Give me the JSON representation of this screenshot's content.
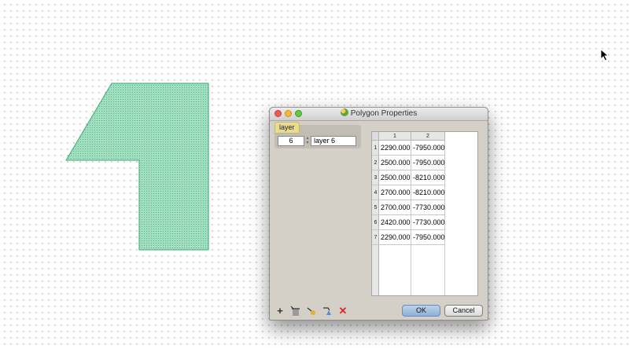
{
  "dialog": {
    "title": "Polygon Properties",
    "layer_group_label": "layer",
    "layer_number": "6",
    "layer_name": "layer 6",
    "table": {
      "columns": [
        "1",
        "2"
      ],
      "rows": [
        {
          "index": "1",
          "x": "2290.000",
          "y": "-7950.000"
        },
        {
          "index": "2",
          "x": "2500.000",
          "y": "-7950.000"
        },
        {
          "index": "3",
          "x": "2500.000",
          "y": "-8210.000"
        },
        {
          "index": "4",
          "x": "2700.000",
          "y": "-8210.000"
        },
        {
          "index": "5",
          "x": "2700.000",
          "y": "-7730.000"
        },
        {
          "index": "6",
          "x": "2420.000",
          "y": "-7730.000"
        },
        {
          "index": "7",
          "x": "2290.000",
          "y": "-7950.000"
        }
      ]
    },
    "toolbar_icons": [
      "add-point-icon",
      "delete-point-icon",
      "move-up-icon",
      "move-down-icon",
      "remove-icon"
    ],
    "ok_label": "OK",
    "cancel_label": "Cancel"
  },
  "colors": {
    "polygon_fill": "#9fdcbe",
    "polygon_stroke": "#3aaa75",
    "dialog_bg": "#d4d0c8"
  }
}
